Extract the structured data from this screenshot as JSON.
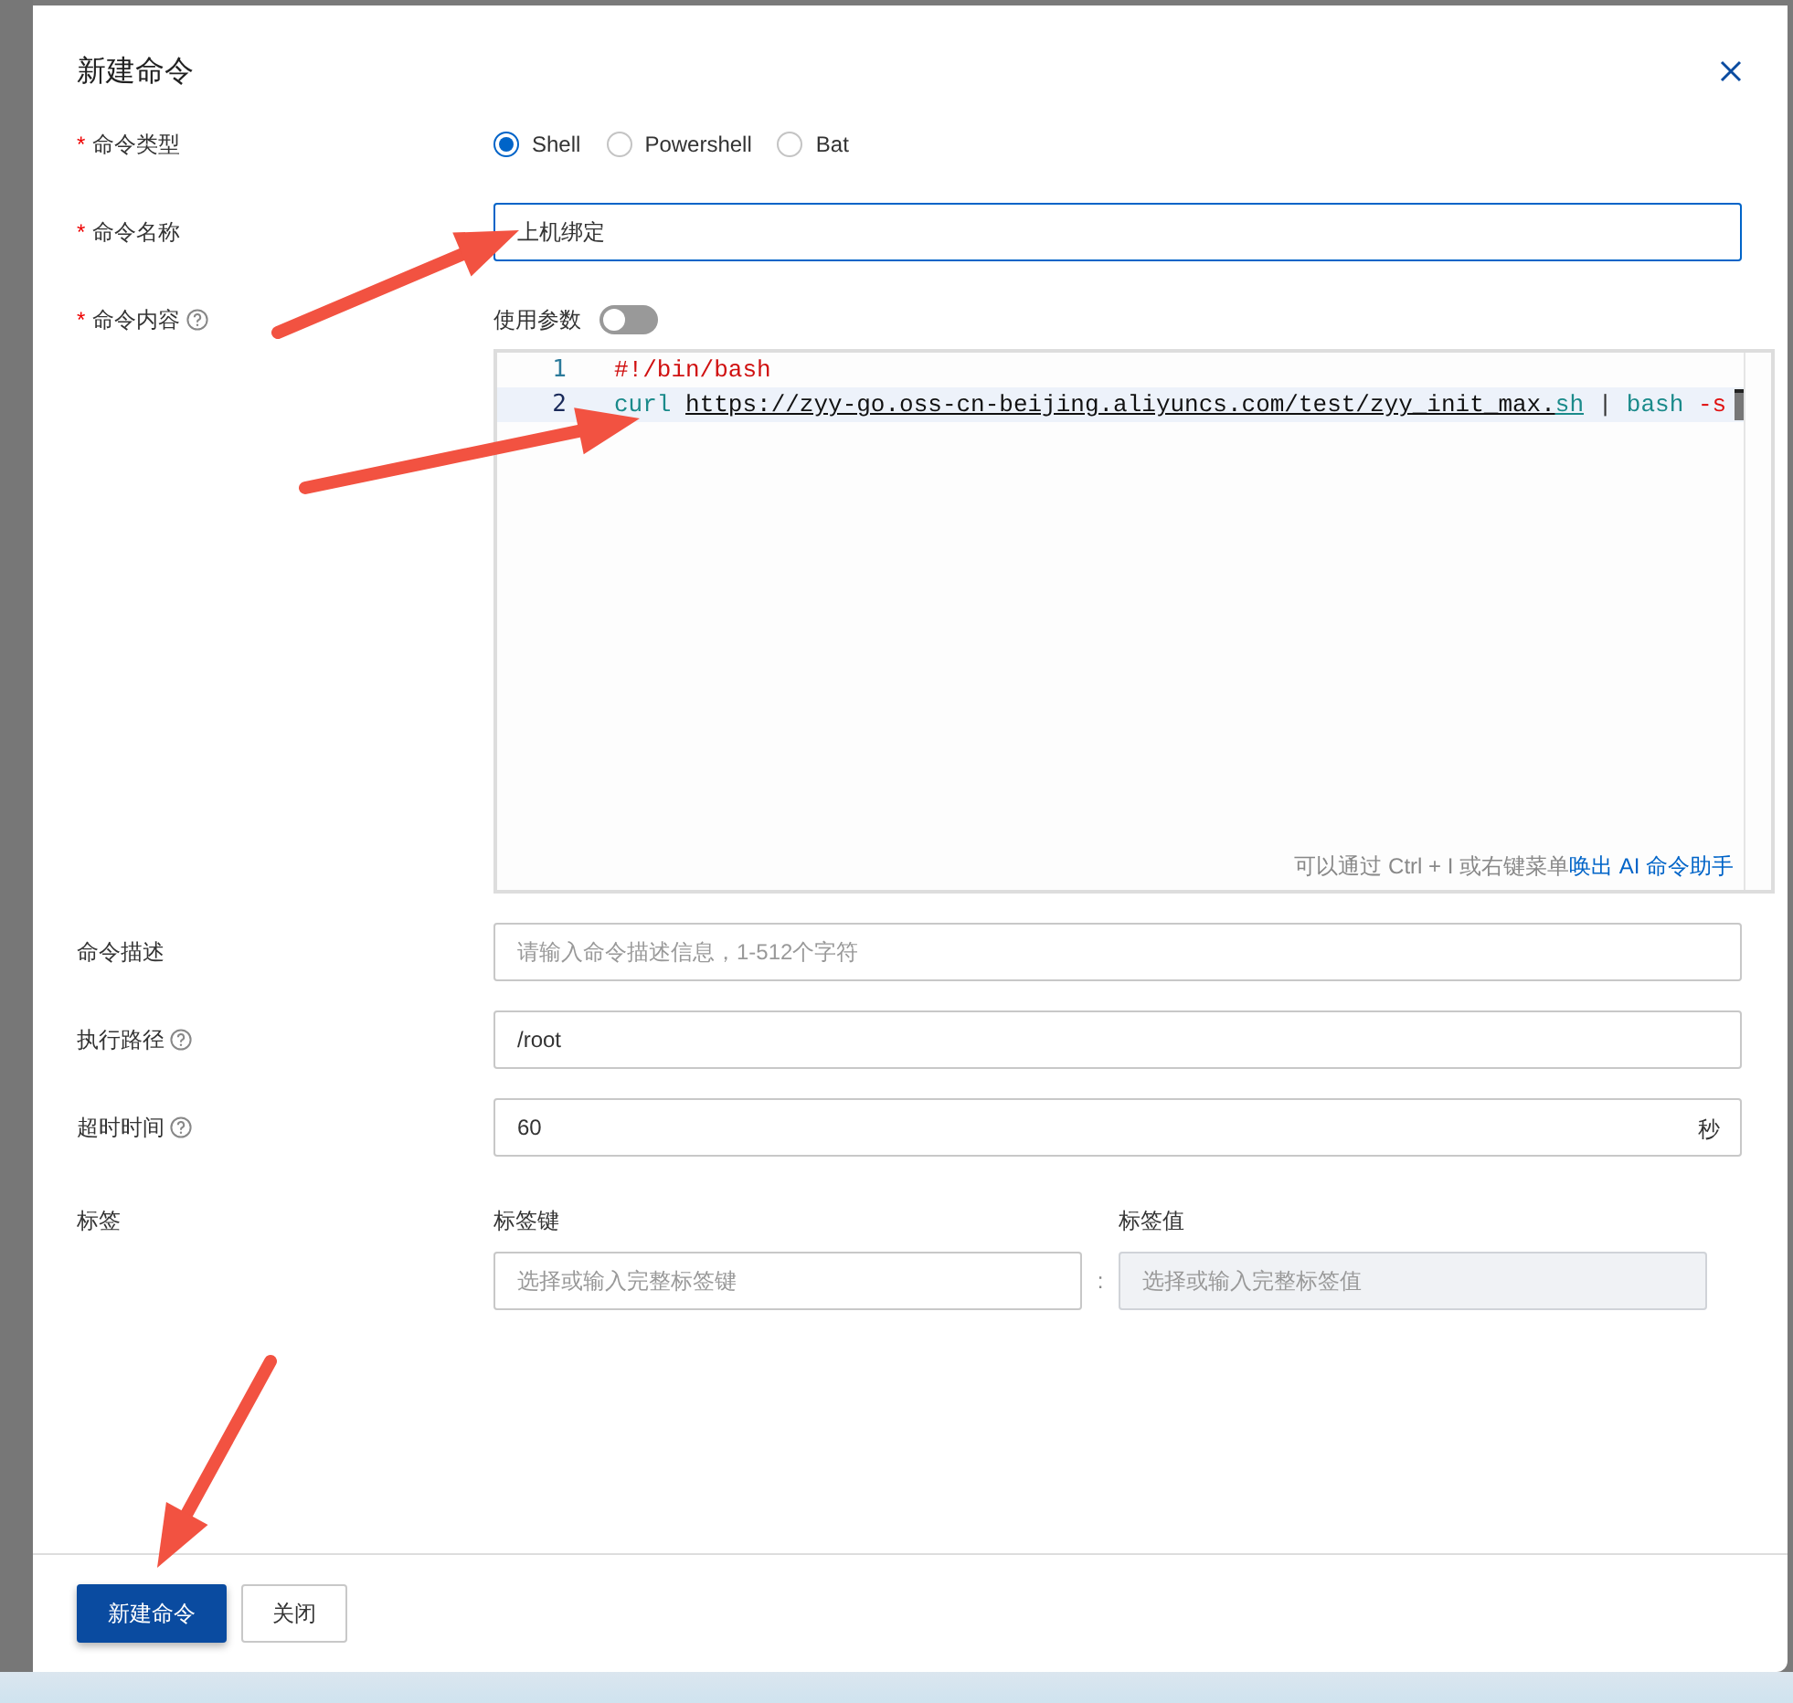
{
  "dialog": {
    "title": "新建命令"
  },
  "command_type": {
    "label": "命令类型",
    "required": "*",
    "options": [
      {
        "label": "Shell",
        "selected": true
      },
      {
        "label": "Powershell",
        "selected": false
      },
      {
        "label": "Bat",
        "selected": false
      }
    ]
  },
  "command_name": {
    "label": "命令名称",
    "required": "*",
    "value": "上机绑定",
    "focused": true
  },
  "command_content": {
    "label": "命令内容",
    "required": "*",
    "help": true,
    "use_params": {
      "label": "使用参数",
      "on": false
    },
    "lines": [
      {
        "number": "1",
        "active": false,
        "tokens": [
          {
            "kind": "comment",
            "text": "#!/bin/bash",
            "attached": true
          }
        ]
      },
      {
        "number": "2",
        "active": true,
        "tokens": [
          {
            "kind": "keyword",
            "text": "curl",
            "attached": true
          },
          {
            "kind": "url",
            "text": "https://zyy-go.oss-cn-beijing.aliyuncs.com/test/zyy_init_max.",
            "attached": false
          },
          {
            "kind": "ext",
            "text": "sh",
            "attached": true
          },
          {
            "kind": "plain",
            "text": "|",
            "attached": false
          },
          {
            "kind": "keyword",
            "text": "bash",
            "attached": false
          },
          {
            "kind": "flag",
            "text": "-s",
            "attached": false
          }
        ]
      }
    ],
    "hint": "可以通过 Ctrl + I 或右键菜单",
    "hint_link": "唤出 AI 命令助手"
  },
  "fields": [
    {
      "label": "命令描述",
      "help": false,
      "placeholder": "请输入命令描述信息，1-512个字符"
    },
    {
      "label": "执行路径",
      "help": true,
      "value": "/root"
    },
    {
      "label": "超时时间",
      "help": true,
      "value": "60",
      "suffix": "秒"
    }
  ],
  "tags": {
    "label": "标签",
    "key_header": "标签键",
    "value_header": "标签值",
    "key_placeholder": "选择或输入完整标签键",
    "separator": ":",
    "value_placeholder": "选择或输入完整标签值",
    "value_disabled": true
  },
  "buttons": [
    {
      "label": "新建命令",
      "kind": "primary"
    },
    {
      "label": "关闭",
      "kind": "default"
    }
  ]
}
